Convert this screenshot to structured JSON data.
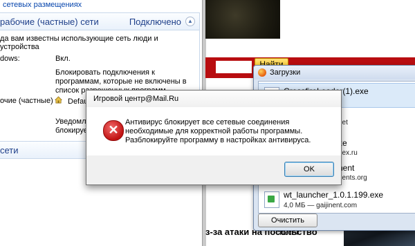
{
  "firewall": {
    "top_link": "сетевых размещениях",
    "private_section": {
      "title": "рабочие (частные) сети",
      "status": "Подключено",
      "description": "да вам известны использующие сеть люди и устройства",
      "rows": [
        {
          "label": "dows:",
          "value": "Вкл."
        },
        {
          "label": "",
          "value": "Блокировать подключения к программам, которые не включены в список разрешенных программ"
        },
        {
          "label": "очие (частные)",
          "value": "Defau"
        },
        {
          "label": "",
          "value": "Уведомлят блокирует"
        }
      ]
    },
    "public_section": {
      "title": "сети"
    }
  },
  "browser": {
    "search_button": "Найти",
    "headline": "з-за атаки на посольство"
  },
  "downloads": {
    "title": "Загрузки",
    "items": [
      {
        "name": "CrossfireLoader(1).exe",
        "meta": ""
      },
      {
        "name": "",
        "meta": "net"
      },
      {
        "name": "xe",
        "meta": "dex.ru"
      },
      {
        "name": "nent",
        "meta": "nents.org"
      },
      {
        "name": "wt_launcher_1.0.1.199.exe",
        "meta": "4,0 МБ — gaijinent.com"
      }
    ],
    "clear_button": "Очистить список"
  },
  "dialog": {
    "title": "Игровой центр@Mail.Ru",
    "message": "Антивирус блокирует все сетевые соединения необходимые для корректной работы программы. Разблокируйте программу в настройках антивируса.",
    "ok_button": "OK",
    "icon": "error-icon"
  },
  "colors": {
    "accent_red": "#b80d10",
    "link_blue": "#0645ad",
    "error_red": "#c11212"
  }
}
